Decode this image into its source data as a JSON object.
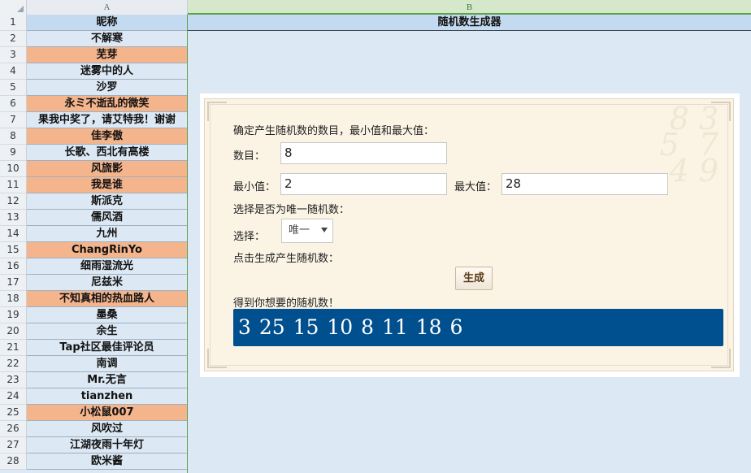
{
  "sheet": {
    "column_headers": [
      "A",
      "B"
    ],
    "row_numbers": [
      "1",
      "2",
      "3",
      "4",
      "5",
      "6",
      "7",
      "8",
      "9",
      "10",
      "11",
      "12",
      "13",
      "14",
      "15",
      "16",
      "17",
      "18",
      "19",
      "20",
      "21",
      "22",
      "23",
      "24",
      "25",
      "26",
      "27",
      "28"
    ],
    "column_a": [
      "昵称",
      "不解寒",
      "芜芽",
      "迷雾中的人",
      "沙罗",
      "永ミ不逝乱的微笑",
      "果我中奖了，请艾特我！谢谢",
      "佳李傲",
      "长歌、西北有高楼",
      "风旒影",
      "我是谁",
      "斯派克",
      "儒风酒",
      "九州",
      "ChangRinYo",
      "细雨湿流光",
      "尼兹米",
      "不知真相的热血路人",
      "墨桑",
      "余生",
      "Tap社区最佳评论员",
      "南调",
      "Mr.无言",
      "tianzhen",
      "小松鼠007",
      "风吹过",
      "江湖夜雨十年灯",
      "欧米酱"
    ],
    "b1_title": "随机数生成器"
  },
  "generator": {
    "intro": "确定产生随机数的数目，最小值和最大值：",
    "count_label": "数目：",
    "count_value": "8",
    "min_label": "最小值：",
    "min_value": "2",
    "max_label": "最大值：",
    "max_value": "28",
    "unique_prompt": "选择是否为唯一随机数：",
    "select_label": "选择：",
    "select_value": "唯一",
    "generate_prompt": "点击生成产生随机数：",
    "generate_button": "生成",
    "result_label": "得到你想要的随机数！",
    "result_numbers": "3 25 15 10 8 11 18 6"
  },
  "colors": {
    "orange_rows": [
      3,
      6,
      8,
      10,
      11,
      15,
      18,
      25
    ],
    "result_bg": "#004f8f",
    "row_highlight": "#f4b48c"
  }
}
